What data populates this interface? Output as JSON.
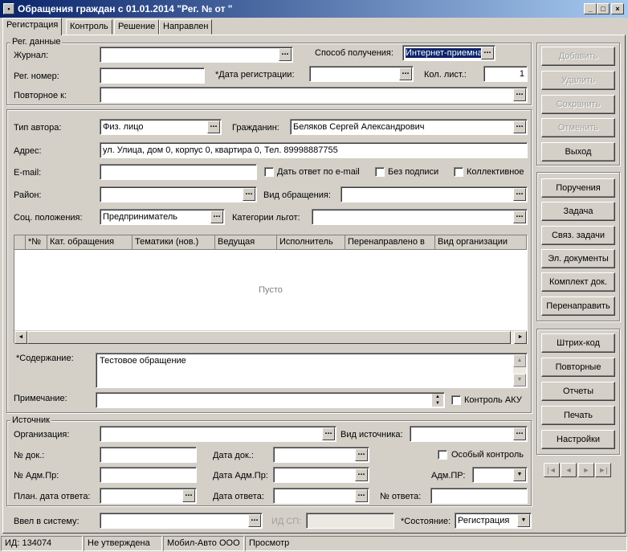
{
  "window": {
    "title": "Обращения граждан с 01.01.2014 \"Рег. № от \"",
    "controls": [
      "_",
      "□",
      "×"
    ]
  },
  "tabs": [
    "Регистрация",
    "Контроль",
    "Решение",
    "Направлен"
  ],
  "reg": {
    "group": "Рег. данные",
    "journal_label": "Журнал:",
    "journal_value": "",
    "method_label": "Способ получения:",
    "method_value": "Интернет-приемна",
    "regnum_label": "Рег. номер:",
    "regnum_value": "",
    "regdate_label": "*Дата регистрации:",
    "regdate_value": "",
    "sheets_label": "Кол. лист.:",
    "sheets_value": "1",
    "repeat_label": "Повторное к:",
    "repeat_value": ""
  },
  "author": {
    "type_label": "Тип автора:",
    "type_value": "Физ. лицо",
    "citizen_label": "Гражданин:",
    "citizen_value": "Беляков Сергей Александрович",
    "address_label": "Адрес:",
    "address_value": "ул. Улица, дом 0, корпус 0, квартира 0, Тел. 89998887755",
    "email_label": "E-mail:",
    "email_value": "",
    "email_answer": "Дать ответ по e-mail",
    "no_signature": "Без подписи",
    "collective": "Коллективное",
    "district_label": "Район:",
    "district_value": "",
    "kind_label": "Вид обращения:",
    "kind_value": "",
    "social_label": "Соц. положения:",
    "social_value": "Предприниматель",
    "benefit_label": "Категории льгот:",
    "benefit_value": ""
  },
  "table": {
    "columns": [
      "*№",
      "Кат. обращения",
      "Тематики (нов.)",
      "Ведущая",
      "Исполнитель",
      "Перенаправлено в",
      "Вид организации"
    ],
    "empty": "Пусто"
  },
  "content": {
    "label": "*Содержание:",
    "value": "Тестовое обращение",
    "note_label": "Примечание:",
    "note_value": "",
    "aku": "Контроль АКУ"
  },
  "source": {
    "group": "Источник",
    "org_label": "Организация:",
    "org_value": "",
    "srckind_label": "Вид источника:",
    "srckind_value": "",
    "docnum_label": "№ док.:",
    "docnum_value": "",
    "docdate_label": "Дата док.:",
    "docdate_value": "",
    "special": "Особый контроль",
    "admnum_label": "№ Адм.Пр:",
    "admnum_value": "",
    "admdate_label": "Дата Адм.Пр:",
    "admdate_value": "",
    "adm_label": "Адм.ПР:",
    "adm_value": "",
    "plan_label": "План. дата ответа:",
    "plan_value": "",
    "ansdate_label": "Дата ответа:",
    "ansdate_value": "",
    "ansnum_label": "№ ответа:",
    "ansnum_value": ""
  },
  "bottom": {
    "entered_label": "Ввел в систему:",
    "entered_value": "",
    "idsp_label": "ИД СП:",
    "idsp_value": "",
    "state_label": "*Состояние:",
    "state_value": "Регистрация"
  },
  "actions": {
    "add": "Добавить",
    "delete": "Удалить",
    "save": "Сохранить",
    "cancel": "Отменить",
    "exit": "Выход"
  },
  "tasks": {
    "orders": "Поручения",
    "task": "Задача",
    "linked": "Связ. задачи",
    "edocs": "Эл. документы",
    "kit": "Комплект док.",
    "redirect": "Перенаправить"
  },
  "misc": {
    "barcode": "Штрих-код",
    "repeats": "Повторные",
    "reports": "Отчеты",
    "print": "Печать",
    "settings": "Настройки"
  },
  "nav": [
    "|◄",
    "◄",
    "►",
    "►|"
  ],
  "status": {
    "id": "ИД: 134074",
    "approved": "Не утверждена",
    "org": "Мобил-Авто ООО",
    "mode": "Просмотр"
  }
}
